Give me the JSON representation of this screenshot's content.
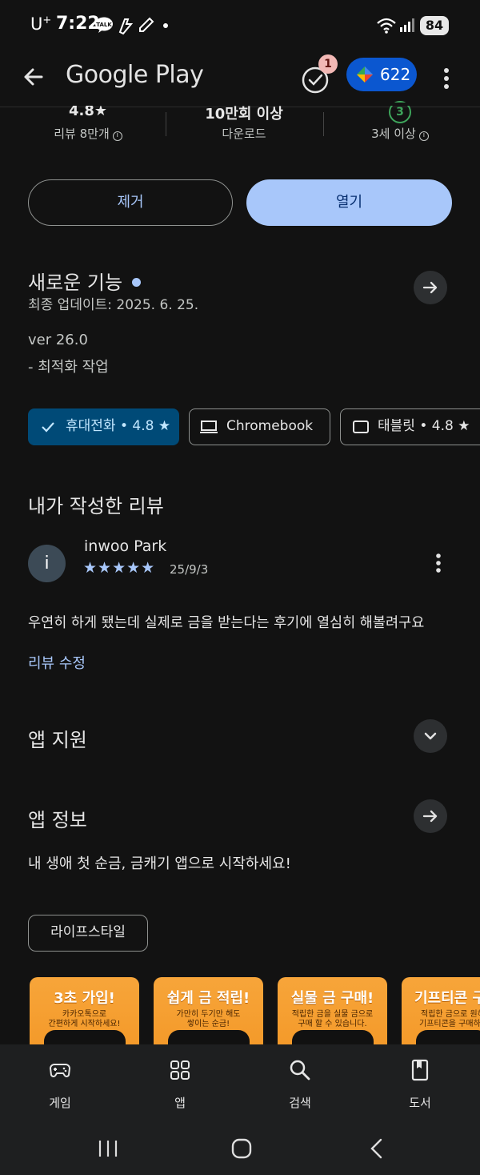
{
  "status_bar": {
    "carrier": "U",
    "carrier_sup": "+",
    "time": "7:22",
    "battery": "84"
  },
  "app_bar": {
    "title": "Google Play",
    "tasks_badge": "1",
    "points": "622"
  },
  "stats": {
    "rating": "4.8★",
    "reviews_label": "리뷰 8만개",
    "downloads": "10만회 이상",
    "downloads_label": "다운로드",
    "age_rating": "3",
    "age_label": "3세 이상"
  },
  "actions": {
    "remove": "제거",
    "open": "열기"
  },
  "whats_new": {
    "title": "새로운 기능",
    "updated": "최종 업데이트: 2025. 6. 25.",
    "version": "ver 26.0",
    "notes": "- 최적화 작업"
  },
  "device_chips": [
    {
      "label": "휴대전화 • 4.8 ★"
    },
    {
      "label": "Chromebook"
    },
    {
      "label": "태블릿 • 4.8 ★"
    }
  ],
  "my_review": {
    "title": "내가 작성한 리뷰",
    "avatar_letter": "i",
    "reviewer": "inwoo Park",
    "stars": "★★★★★",
    "rating_value": 5,
    "date": "25/9/3",
    "text": "우연히 하게 됐는데 실제로 금을 받는다는 후기에 열심히 해볼려구요",
    "edit_link": "리뷰 수정"
  },
  "app_support": {
    "title": "앱 지원"
  },
  "app_info": {
    "title": "앱 정보",
    "description": "내 생애 첫 순금, 금캐기 앱으로 시작하세요!",
    "tag": "라이프스타일"
  },
  "screenshots": [
    {
      "headline": "3초 가입!",
      "sub1": "카카오톡으로",
      "sub2": "간편하게 시작하세요!"
    },
    {
      "headline": "쉽게 금 적립!",
      "sub1": "가만히 두기만 해도",
      "sub2": "쌓이는 순금!"
    },
    {
      "headline": "실물 금 구매!",
      "sub1": "적립한 금을 실물 금으로",
      "sub2": "구매 할 수 있습니다."
    },
    {
      "headline": "기프티콘 구",
      "sub1": "적립한 금으로 원하",
      "sub2": "기프티콘을 구매하"
    }
  ],
  "bottom_nav": {
    "games": "게임",
    "apps": "앱",
    "search": "검색",
    "books": "도서"
  },
  "colors": {
    "background": "#121212",
    "accent": "#a8c7fa",
    "selected_chip": "#004a77",
    "points_button": "#0b57d0",
    "screenshot_orange": "#f7a53a"
  }
}
